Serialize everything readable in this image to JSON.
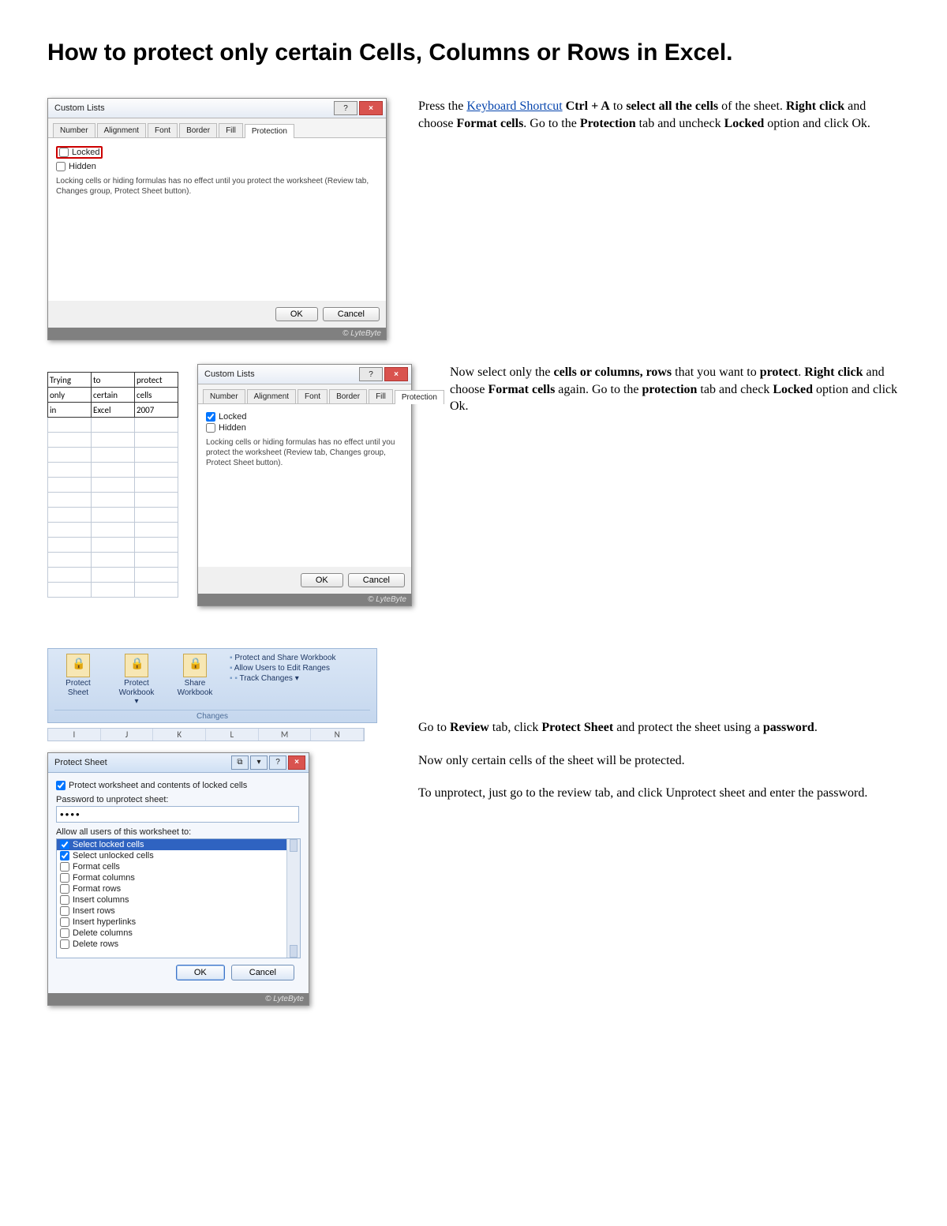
{
  "title": "How to protect only certain Cells, Columns or Rows in Excel.",
  "step1": {
    "link_text": "Keyboard Shortcut",
    "text_before": "Press the ",
    "text_after1": " Ctrl + A",
    "text_after2": " to ",
    "b_selectall": "select all the cells",
    "t1": " of the sheet. ",
    "b_rightclick": "Right click",
    "t2": " and choose ",
    "b_formatcells": "Format cells",
    "t3": ". Go to the ",
    "b_protection": "Protection",
    "t4": " tab and uncheck ",
    "b_locked": "Locked",
    "t5": " option and click Ok."
  },
  "dialog": {
    "title": "Custom Lists",
    "tabs": [
      "Number",
      "Alignment",
      "Font",
      "Border",
      "Fill",
      "Protection"
    ],
    "locked": "Locked",
    "hidden": "Hidden",
    "note": "Locking cells or hiding formulas has no effect until you protect the worksheet (Review tab, Changes group, Protect Sheet button).",
    "ok": "OK",
    "cancel": "Cancel",
    "watermark": "© LyteByte"
  },
  "step2": {
    "t0": "Now select only the ",
    "b_cells": "cells or columns, rows",
    "t1": " that you want to ",
    "b_protect": "protect",
    "t2": ". ",
    "b_rightclick": "Right click",
    "t3": " and choose ",
    "b_formatcells": "Format cells",
    "t4": " again. Go to the ",
    "b_protection": "protection",
    "t5": " tab and check ",
    "b_locked": "Locked",
    "t6": " option and click Ok."
  },
  "xlcells": [
    [
      "Trying",
      "to",
      "protect"
    ],
    [
      "only",
      "certain",
      "cells"
    ],
    [
      "in",
      "Excel",
      "2007"
    ]
  ],
  "step3": {
    "p1a": "Go to ",
    "b_review": "Review",
    "p1b": " tab, click ",
    "b_ps": "Protect Sheet",
    "p1c": " and protect the sheet using a ",
    "b_pw": "password",
    "p1d": ".",
    "p2": "Now only certain cells of the sheet will be protected.",
    "p3": "To unprotect, just go to the review tab, and click Unprotect sheet and enter the password."
  },
  "ribbon": {
    "protect_sheet": "Protect Sheet",
    "protect_workbook": "Protect Workbook",
    "share_workbook": "Share Workbook",
    "side1": "Protect and Share Workbook",
    "side2": "Allow Users to Edit Ranges",
    "side3": "Track Changes",
    "group": "Changes",
    "cols": [
      "I",
      "J",
      "K",
      "L",
      "M",
      "N"
    ]
  },
  "protect_sheet": {
    "title": "Protect Sheet",
    "chk_main": "Protect worksheet and contents of locked cells",
    "pw_label": "Password to unprotect sheet:",
    "pw_value": "••••",
    "allow_label": "Allow all users of this worksheet to:",
    "perms": [
      {
        "label": "Select locked cells",
        "checked": true,
        "sel": true
      },
      {
        "label": "Select unlocked cells",
        "checked": true
      },
      {
        "label": "Format cells",
        "checked": false
      },
      {
        "label": "Format columns",
        "checked": false
      },
      {
        "label": "Format rows",
        "checked": false
      },
      {
        "label": "Insert columns",
        "checked": false
      },
      {
        "label": "Insert rows",
        "checked": false
      },
      {
        "label": "Insert hyperlinks",
        "checked": false
      },
      {
        "label": "Delete columns",
        "checked": false
      },
      {
        "label": "Delete rows",
        "checked": false
      }
    ],
    "ok": "OK",
    "cancel": "Cancel"
  }
}
